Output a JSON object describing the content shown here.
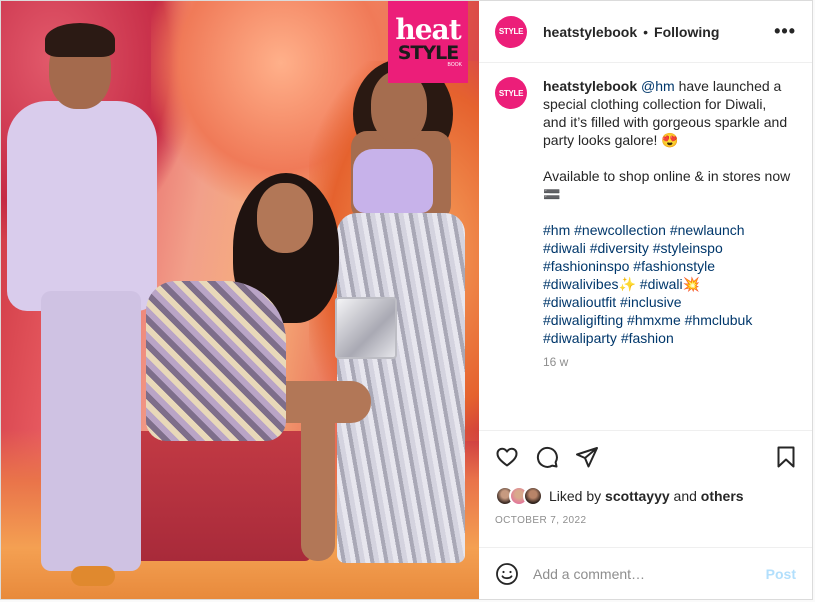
{
  "photo": {
    "logo_top": "heat",
    "logo_bottom": "STYLE",
    "logo_small": "BOOK"
  },
  "header": {
    "avatar_text": "STYLE",
    "username": "heatstylebook",
    "separator": "•",
    "follow_state": "Following",
    "more_icon": "more-icon"
  },
  "caption": {
    "avatar_text": "STYLE",
    "username": "heatstylebook",
    "mention": "@hm",
    "text1": " have launched a special clothing collection for Diwali, and it’s filled with gorgeous sparkle and party looks galore! 😍",
    "text2": "Available to shop online & in stores now 🟰",
    "hashtag_lines": [
      "#hm #newcollection #newlaunch",
      "#diwali #diversity #styleinspo",
      "#fashioninspo #fashionstyle",
      "#diwalivibes✨ #diwali💥",
      "#diwalioutfit #inclusive",
      "#diwaligifting #hmxme #hmclubuk",
      "#diwaliparty #fashion"
    ],
    "time": "16 w"
  },
  "actions": {
    "like_icon": "heart-icon",
    "comment_icon": "comment-icon",
    "share_icon": "share-icon",
    "save_icon": "bookmark-icon"
  },
  "likes": {
    "prefix": "Liked by ",
    "user": "scottayyy",
    "middle": " and ",
    "others": "others"
  },
  "date": "OCTOBER 7, 2022",
  "comment": {
    "emoji_icon": "smiley-icon",
    "placeholder": "Add a comment…",
    "post_label": "Post"
  },
  "colors": {
    "brand_pink": "#ec1e79",
    "link": "#00376b",
    "muted": "#8e8e8e",
    "post_disabled": "#b2dffc"
  }
}
